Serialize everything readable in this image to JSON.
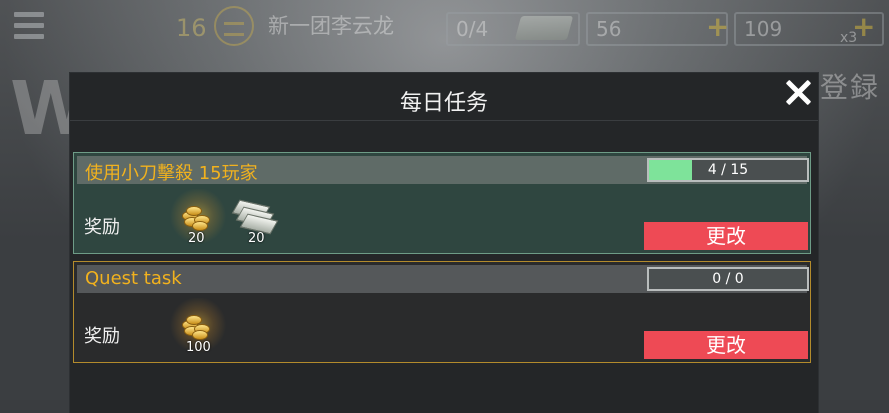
{
  "hud": {
    "level": "16",
    "player_name": "新一团李云龙",
    "cash_count": "0/4",
    "gold_count": "56",
    "xp_count": "109",
    "multiplier": "x3"
  },
  "background": {
    "big_letter": "W",
    "banner_text": "公改半地登録"
  },
  "modal": {
    "title": "每日任务",
    "quests": [
      {
        "name": "使用小刀擊殺 15玩家",
        "progress_text": "4 / 15",
        "progress_fraction": 0.27,
        "reward_label": "奖励",
        "rewards": [
          {
            "icon": "gold-coins-icon",
            "amount": "20"
          },
          {
            "icon": "cash-icon",
            "amount": "20"
          }
        ],
        "change_label": "更改"
      },
      {
        "name": "Quest task",
        "progress_text": "0 / 0",
        "progress_fraction": 0,
        "reward_label": "奖励",
        "rewards": [
          {
            "icon": "gold-coins-icon",
            "amount": "100"
          }
        ],
        "change_label": "更改"
      }
    ]
  },
  "colors": {
    "accent_gold": "#f2b21e",
    "button_red": "#ee4a55",
    "progress_green": "#7ee39a",
    "active_border": "#6e9c87",
    "inactive_border": "#b38b2c"
  }
}
